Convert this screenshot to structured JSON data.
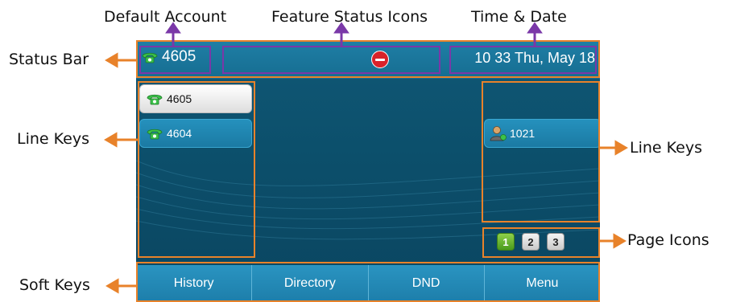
{
  "callouts": {
    "default_account": "Default Account",
    "feature_status_icons": "Feature Status Icons",
    "time_date": "Time & Date",
    "status_bar": "Status Bar",
    "line_keys_left": "Line Keys",
    "line_keys_right": "Line Keys",
    "page_icons": "Page Icons",
    "soft_keys": "Soft Keys"
  },
  "status_bar": {
    "account": "4605",
    "time": "10 33 Thu, May 18",
    "feature_icon": "dnd-icon"
  },
  "line_keys": [
    {
      "label": "4605",
      "icon": "phone-handset-icon",
      "active": true
    },
    {
      "label": "4604",
      "icon": "phone-handset-icon",
      "active": false
    },
    {
      "label": "1021",
      "icon": "contact-person-icon",
      "active": false
    }
  ],
  "page_icons": [
    {
      "label": "1",
      "selected": true
    },
    {
      "label": "2",
      "selected": false
    },
    {
      "label": "3",
      "selected": false
    }
  ],
  "soft_keys": [
    "History",
    "Directory",
    "DND",
    "Menu"
  ],
  "colors": {
    "annotation_orange": "#e8822a",
    "annotation_purple": "#7a38a8",
    "screen_bg": "#0c4f6b",
    "key_blue": "#1f86b1"
  }
}
